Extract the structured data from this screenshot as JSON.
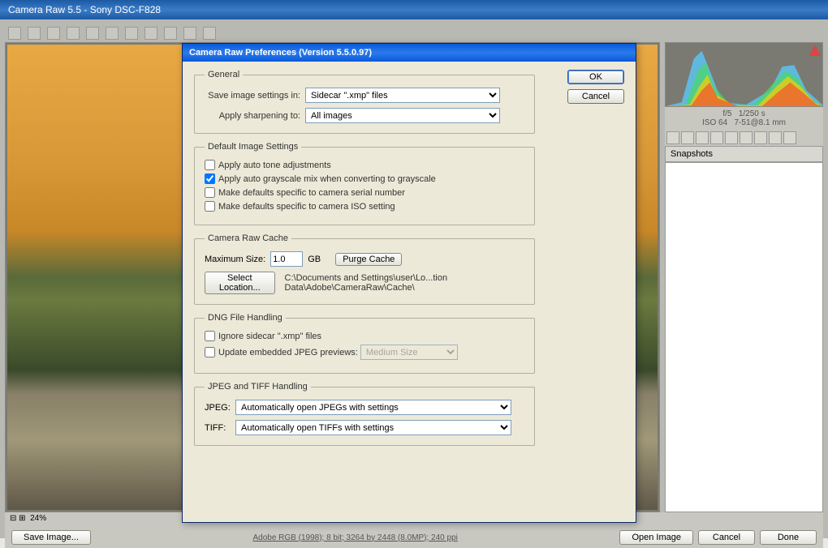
{
  "window": {
    "title": "Camera Raw 5.5  -  Sony DSC-F828"
  },
  "dialog": {
    "title": "Camera Raw Preferences  (Version 5.5.0.97)",
    "ok": "OK",
    "cancel": "Cancel",
    "general": {
      "legend": "General",
      "save_label": "Save image settings in:",
      "save_value": "Sidecar \".xmp\" files",
      "sharpen_label": "Apply sharpening to:",
      "sharpen_value": "All images"
    },
    "defaults": {
      "legend": "Default Image Settings",
      "auto_tone": "Apply auto tone adjustments",
      "auto_gray": "Apply auto grayscale mix when converting to grayscale",
      "serial": "Make defaults specific to camera serial number",
      "iso": "Make defaults specific to camera ISO setting"
    },
    "cache": {
      "legend": "Camera Raw Cache",
      "max_label": "Maximum Size:",
      "max_value": "1.0",
      "gb": "GB",
      "purge": "Purge Cache",
      "select": "Select Location...",
      "path": "C:\\Documents and Settings\\user\\Lo...tion Data\\Adobe\\CameraRaw\\Cache\\"
    },
    "dng": {
      "legend": "DNG File Handling",
      "ignore": "Ignore sidecar \".xmp\" files",
      "update": "Update embedded JPEG previews:",
      "size": "Medium Size"
    },
    "jpegtiff": {
      "legend": "JPEG and TIFF Handling",
      "jpeg_label": "JPEG:",
      "jpeg_value": "Automatically open JPEGs with settings",
      "tiff_label": "TIFF:",
      "tiff_value": "Automatically open TIFFs with settings"
    }
  },
  "info": {
    "line1a": "f/5",
    "line1b": "1/250 s",
    "line2a": "ISO 64",
    "line2b": "7-51@8.1 mm"
  },
  "snapshots": "Snapshots",
  "zoom": "24%",
  "bottom": {
    "save": "Save Image...",
    "meta": "Adobe RGB (1998); 8 bit; 3264 by 2448 (8.0MP); 240 ppi",
    "open": "Open Image",
    "cancel": "Cancel",
    "done": "Done"
  }
}
